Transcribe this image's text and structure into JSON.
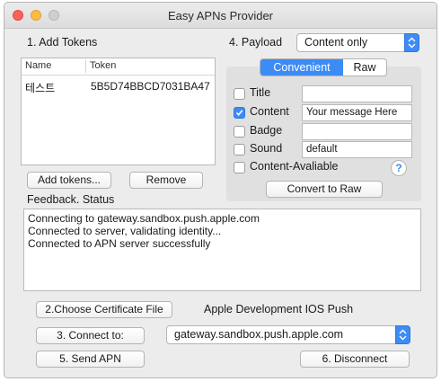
{
  "window": {
    "title": "Easy APNs Provider"
  },
  "tokens": {
    "heading": "1. Add Tokens",
    "columns": {
      "name": "Name",
      "token": "Token"
    },
    "rows": [
      {
        "name": "테스트",
        "token": "5B5D74BBCD7031BA47"
      }
    ],
    "add_button": "Add tokens...",
    "remove_button": "Remove"
  },
  "payload": {
    "heading": "4. Payload",
    "mode_value": "Content only",
    "tabs": {
      "convenient": "Convenient",
      "raw": "Raw"
    },
    "fields": {
      "title": {
        "label": "Title",
        "checked": false,
        "value": ""
      },
      "content": {
        "label": "Content",
        "checked": true,
        "value": "Your message Here"
      },
      "badge": {
        "label": "Badge",
        "checked": false,
        "value": ""
      },
      "sound": {
        "label": "Sound",
        "checked": false,
        "value": "default"
      },
      "content_available": {
        "label": "Content-Avaliable",
        "checked": false
      }
    },
    "help": "?",
    "convert_button": "Convert to Raw"
  },
  "feedback": {
    "heading": "Feedback. Status",
    "lines": [
      "Connecting to gateway.sandbox.push.apple.com",
      "Connected to server, validating identity...",
      "Connected to APN server successfully"
    ]
  },
  "certificate": {
    "button": "2.Choose Certificate File",
    "name": "Apple Development IOS Push"
  },
  "connect": {
    "button": "3. Connect to:",
    "server_value": "gateway.sandbox.push.apple.com"
  },
  "send_button": "5. Send APN",
  "disconnect_button": "6. Disconnect",
  "colors": {
    "accent": "#3d8bf5"
  }
}
